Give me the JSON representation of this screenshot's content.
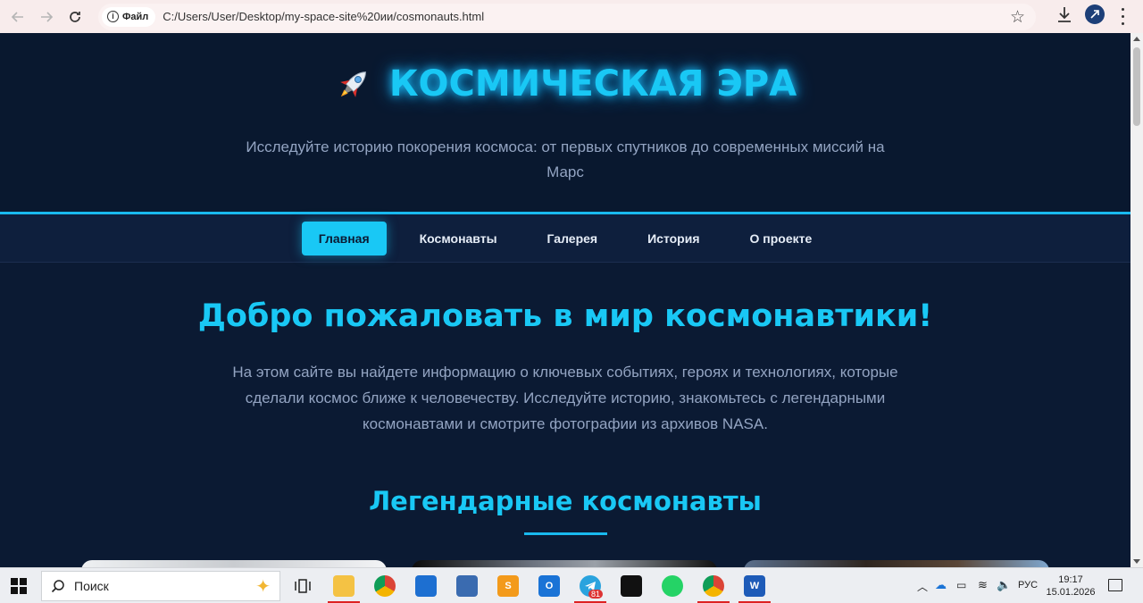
{
  "browser": {
    "file_label": "Файл",
    "url": "C:/Users/User/Desktop/my-space-site%20ии/cosmonauts.html"
  },
  "header": {
    "title": "КОСМИЧЕСКАЯ ЭРА",
    "tagline": "Исследуйте историю покорения космоса: от первых спутников до современных миссий на Марс"
  },
  "nav": {
    "items": [
      {
        "label": "Главная",
        "active": true
      },
      {
        "label": "Космонавты"
      },
      {
        "label": "Галерея"
      },
      {
        "label": "История"
      },
      {
        "label": "О проекте"
      }
    ]
  },
  "main": {
    "welcome_title": "Добро пожаловать в мир космонавтики!",
    "welcome_text": "На этом сайте вы найдете информацию о ключевых событиях, героях и технологиях, которые сделали космос ближе к человечеству. Исследуйте историю, знакомьтесь с легендарными космонавтами и смотрите фотографии из архивов NASA.",
    "section_title": "Легендарные космонавты"
  },
  "taskbar": {
    "search_placeholder": "Поиск",
    "language": "РУС",
    "time": "19:17",
    "date": "15.01.2026",
    "telegram_badge": "81"
  },
  "colors": {
    "accent": "#19c8f5",
    "page_bg": "#0b1a33",
    "nav_bg": "#0e1f3d",
    "muted_text": "#93a4c2"
  }
}
